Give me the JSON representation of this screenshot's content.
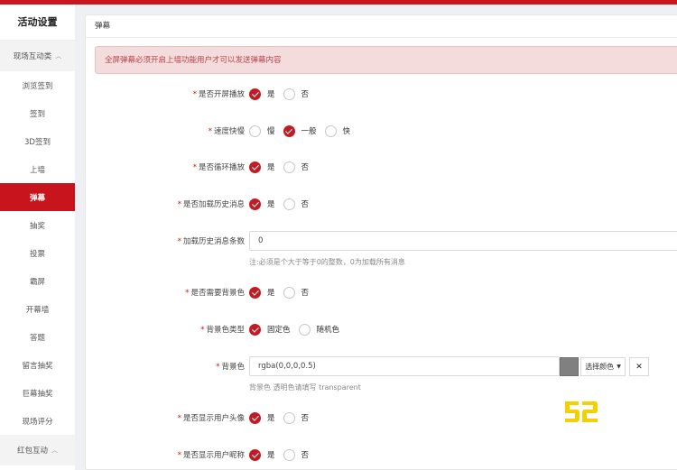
{
  "sidebar": {
    "title": "活动设置",
    "group1": "现场互动类",
    "items": [
      "浏览签到",
      "签到",
      "3D签到",
      "上墙",
      "弹幕",
      "抽奖",
      "投票",
      "霸屏",
      "开幕墙",
      "答题",
      "留言抽奖",
      "巨幕抽奖",
      "现场评分"
    ],
    "active": "弹幕",
    "group2": "红包互动"
  },
  "panel": {
    "title": "弹幕",
    "alert": "全屏弹幕必须开启上墙功能用户才可以发送弹幕内容"
  },
  "form": {
    "fullscreen": {
      "label": "是否开屏播放",
      "options": [
        "是",
        "否"
      ],
      "selected": "是"
    },
    "speed": {
      "label": "速度快慢",
      "options": [
        "慢",
        "一般",
        "快"
      ],
      "selected": "一般"
    },
    "loop": {
      "label": "是否循环播放",
      "options": [
        "是",
        "否"
      ],
      "selected": "是"
    },
    "history": {
      "label": "是否加载历史消息",
      "options": [
        "是",
        "否"
      ],
      "selected": "是"
    },
    "history_count": {
      "label": "加载历史消息条数",
      "value": "0",
      "hint": "注:必须是个大于等于0的整数，0为加载所有消息"
    },
    "need_bg": {
      "label": "是否需要背景色",
      "options": [
        "是",
        "否"
      ],
      "selected": "是"
    },
    "bg_type": {
      "label": "背景色类型",
      "options": [
        "固定色",
        "随机色"
      ],
      "selected": "固定色"
    },
    "bg_color": {
      "label": "背景色",
      "value": "rgba(0,0,0,0.5)",
      "picker": "选择颜色",
      "hint": "背景色 透明色请填写 transparent",
      "swatch": "#808080"
    },
    "show_avatar": {
      "label": "是否显示用户头像",
      "options": [
        "是",
        "否"
      ],
      "selected": "是"
    },
    "show_nick": {
      "label": "是否显示用户昵称",
      "options": [
        "是",
        "否"
      ],
      "selected": "是"
    }
  },
  "colors": {
    "accent": "#c8151d",
    "alert_bg": "#f5dcdc",
    "watermark": "#f5d000"
  },
  "watermark_text": "52"
}
